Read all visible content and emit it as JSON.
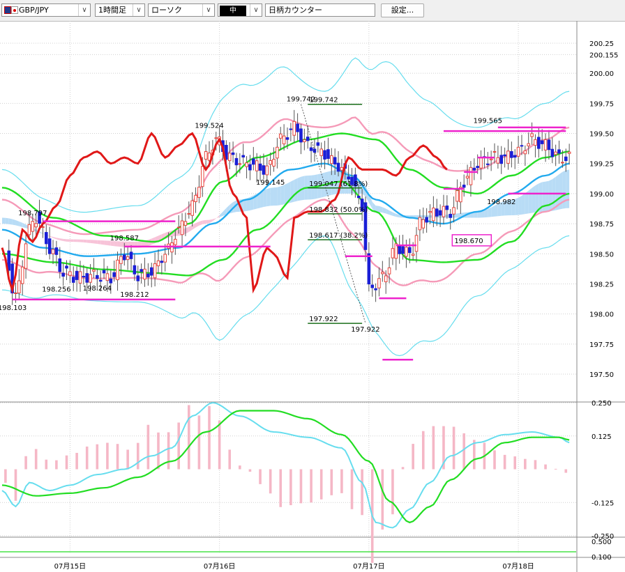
{
  "toolbar": {
    "symbol": "GBP/JPY",
    "timeframe": "1時間足",
    "chart_style": "ローソク",
    "line_style": "中",
    "counter_label": "日柄カウンター",
    "settings_label": "設定..."
  },
  "chart_data": [
    {
      "type": "candlestick",
      "panel": "price",
      "y_ticks": [
        "200.25",
        "200.155",
        "200.00",
        "199.75",
        "199.50",
        "199.25",
        "199.00",
        "198.75",
        "198.50",
        "198.25",
        "198.00",
        "197.75",
        "197.50"
      ],
      "ylim": [
        197.5,
        200.3
      ],
      "x_ticks": [
        "07月15日",
        "07月16日",
        "07月17日",
        "07月18日"
      ],
      "x_tick_index": [
        20,
        64,
        108,
        152
      ],
      "bar_count": 168,
      "price_labels": [
        {
          "text": "198.797",
          "i": 9,
          "v": 198.797
        },
        {
          "text": "198.587",
          "i": 36,
          "v": 198.587
        },
        {
          "text": "198.256",
          "i": 16,
          "v": 198.256
        },
        {
          "text": "198.264",
          "i": 28,
          "v": 198.264
        },
        {
          "text": "198.212",
          "i": 39,
          "v": 198.212
        },
        {
          "text": "198.103",
          "i": 3,
          "v": 198.103
        },
        {
          "text": "199.524",
          "i": 61,
          "v": 199.524
        },
        {
          "text": "199.145",
          "i": 79,
          "v": 199.145
        },
        {
          "text": "199.742",
          "i": 88,
          "v": 199.742
        },
        {
          "text": "197.922",
          "i": 107,
          "v": 197.922
        },
        {
          "text": "199.565",
          "i": 143,
          "v": 199.565
        },
        {
          "text": "198.982",
          "i": 147,
          "v": 198.982
        },
        {
          "text": "198.670",
          "i": 135,
          "v": 198.67
        }
      ],
      "fibonacci": [
        {
          "text": "199.742",
          "v": 199.742
        },
        {
          "text": "199.047 (61.8%)",
          "v": 199.047
        },
        {
          "text": "198.832 (50.0%)",
          "v": 198.832
        },
        {
          "text": "198.617 (38.2%)",
          "v": 198.617
        },
        {
          "text": "197.922",
          "v": 197.922
        }
      ],
      "levels": [
        {
          "v": 198.77,
          "i0": 12,
          "i1": 51
        },
        {
          "v": 198.56,
          "i0": 36,
          "i1": 79
        },
        {
          "v": 198.12,
          "i0": 3,
          "i1": 51
        },
        {
          "v": 199.52,
          "i0": 130,
          "i1": 166
        },
        {
          "v": 199.55,
          "i0": 146,
          "i1": 166
        },
        {
          "v": 199.0,
          "i0": 149,
          "i1": 166
        },
        {
          "v": 199.04,
          "i0": 130,
          "i1": 136
        },
        {
          "v": 199.18,
          "i0": 136,
          "i1": 140
        },
        {
          "v": 199.3,
          "i0": 140,
          "i1": 145
        },
        {
          "v": 198.48,
          "i0": 101,
          "i1": 109
        },
        {
          "v": 198.57,
          "i0": 116,
          "i1": 122
        },
        {
          "v": 198.13,
          "i0": 111,
          "i1": 119
        },
        {
          "v": 197.62,
          "i0": 112,
          "i1": 121
        }
      ],
      "colors": {
        "up": "#e8453c",
        "down": "#1a1fd6",
        "red_line": "#e01818",
        "green": "#22dd22",
        "blue": "#22aaee",
        "pink": "#f59ab8",
        "cyan": "#66ddee",
        "magenta": "#ee22cc"
      }
    },
    {
      "type": "macd",
      "panel": "oscillator",
      "y_ticks": [
        "0.250",
        "0.125",
        "-0.125",
        "-0.250"
      ],
      "ylim": [
        -0.27,
        0.27
      ]
    },
    {
      "type": "line",
      "panel": "bottom",
      "y_ticks": [
        "0.500",
        "0.100"
      ]
    }
  ]
}
